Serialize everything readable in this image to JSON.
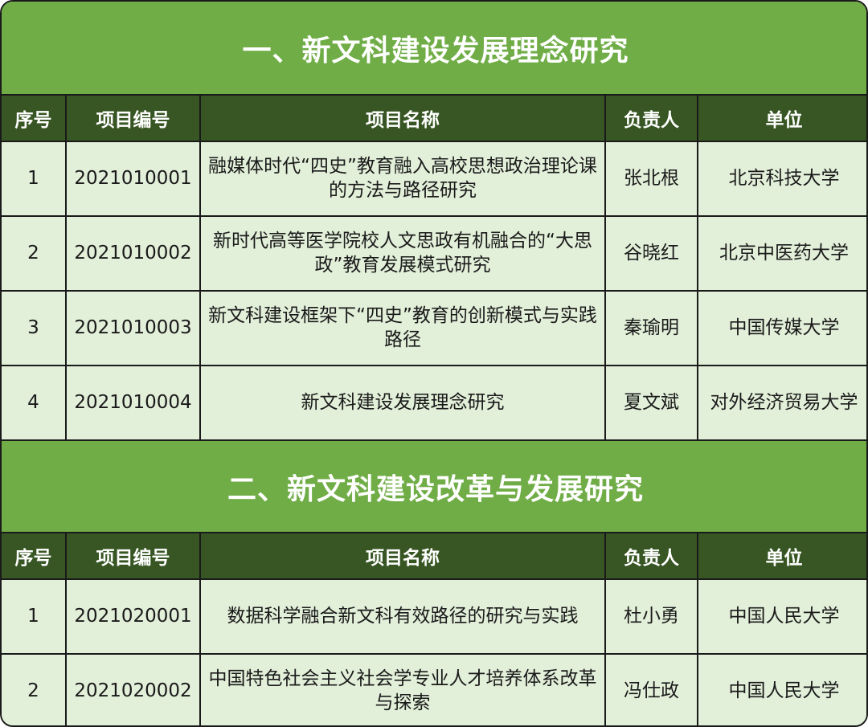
{
  "sections": [
    {
      "title": "一、新文科建设发展理念研究",
      "headers": [
        "序号",
        "项目编号",
        "项目名称",
        "负责人",
        "单位"
      ],
      "rows": [
        {
          "no": "1",
          "code": "2021010001",
          "name": "融媒体时代“四史”教育融入高校思想政治理论课的方法与路径研究",
          "owner": "张北根",
          "unit": "北京科技大学"
        },
        {
          "no": "2",
          "code": "2021010002",
          "name": "新时代高等医学院校人文思政有机融合的“大思政”教育发展模式研究",
          "owner": "谷晓红",
          "unit": "北京中医药大学"
        },
        {
          "no": "3",
          "code": "2021010003",
          "name": "新文科建设框架下“四史”教育的创新模式与实践路径",
          "owner": "秦瑜明",
          "unit": "中国传媒大学"
        },
        {
          "no": "4",
          "code": "2021010004",
          "name": "新文科建设发展理念研究",
          "owner": "夏文斌",
          "unit": "对外经济贸易大学"
        }
      ]
    },
    {
      "title": "二、新文科建设改革与发展研究",
      "headers": [
        "序号",
        "项目编号",
        "项目名称",
        "负责人",
        "单位"
      ],
      "rows": [
        {
          "no": "1",
          "code": "2021020001",
          "name": "数据科学融合新文科有效路径的研究与实践",
          "owner": "杜小勇",
          "unit": "中国人民大学"
        },
        {
          "no": "2",
          "code": "2021020002",
          "name": "中国特色社会主义社会学专业人才培养体系改革与探索",
          "owner": "冯仕政",
          "unit": "中国人民大学"
        }
      ]
    }
  ],
  "colors": {
    "title_bg": "#70ad47",
    "header_bg": "#375623",
    "row_bg": "#e2efd9",
    "border": "#1a1a1a"
  }
}
